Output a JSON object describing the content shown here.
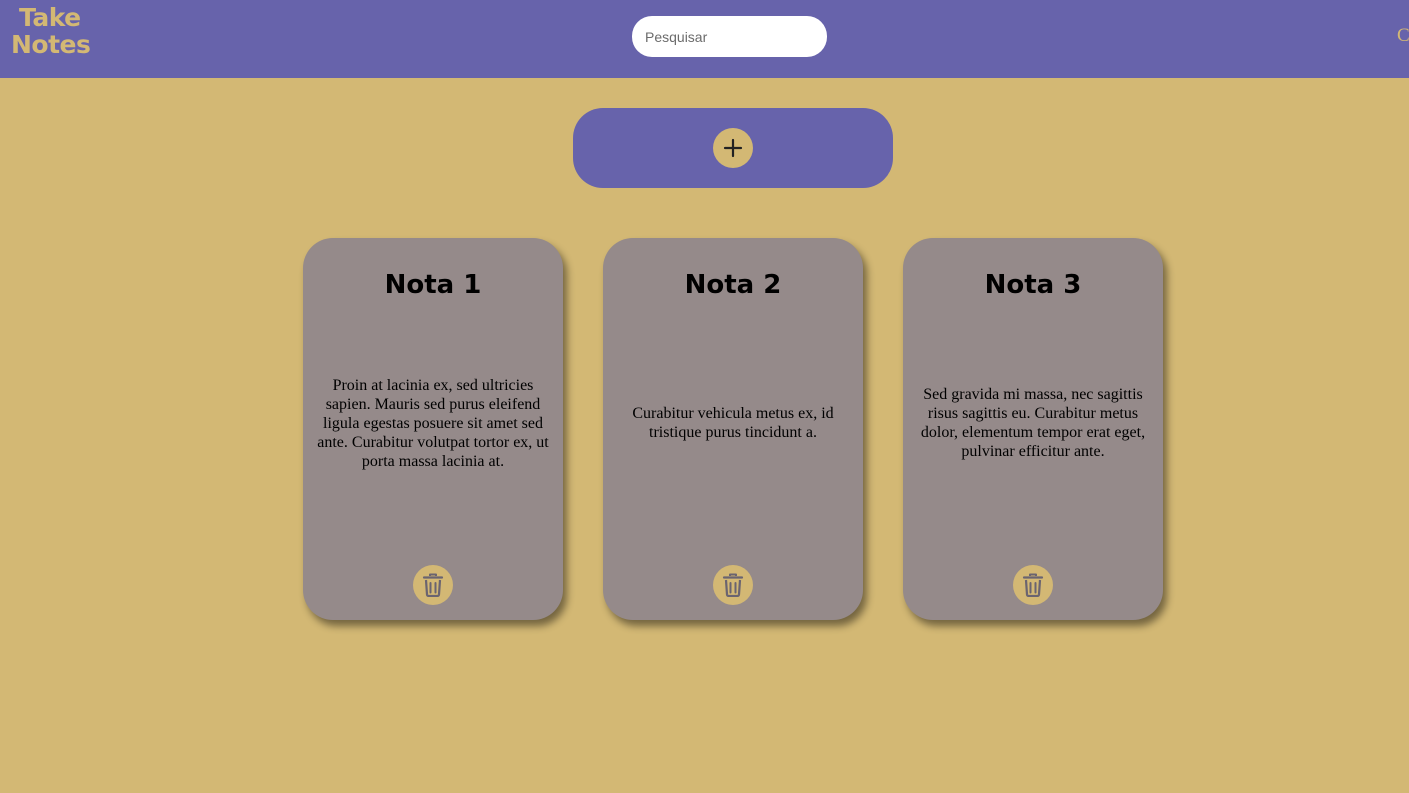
{
  "header": {
    "logo_line1": "Take",
    "logo_line2": "Notes",
    "search_placeholder": "Pesquisar",
    "right_text": "C"
  },
  "add_note": {
    "icon": "plus-icon"
  },
  "notes": [
    {
      "title": "Nota 1",
      "body": "Proin at lacinia ex, sed ultricies sapien. Mauris sed purus eleifend ligula egestas posuere sit amet sed ante. Curabitur volutpat tortor ex, ut porta massa lacinia at.",
      "delete_icon": "trash-icon"
    },
    {
      "title": "Nota 2",
      "body": "Curabitur vehicula metus ex, id tristique purus tincidunt a.",
      "delete_icon": "trash-icon"
    },
    {
      "title": "Nota 3",
      "body": "Sed gravida mi massa, nec sagittis risus sagittis eu. Curabitur metus dolor, elementum tempor erat eget, pulvinar efficitur ante.",
      "delete_icon": "trash-icon"
    }
  ],
  "colors": {
    "header_bg": "#6763ab",
    "page_bg": "#d3b874",
    "card_bg": "#958a8a",
    "accent": "#d3b874"
  }
}
